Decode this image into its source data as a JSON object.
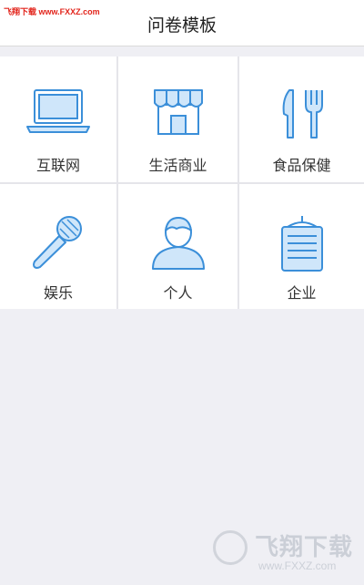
{
  "watermark_top": "飞翔下载 www.FXXZ.com",
  "header": {
    "title": "问卷模板"
  },
  "categories": [
    {
      "label": "互联网",
      "icon": "laptop-icon"
    },
    {
      "label": "生活商业",
      "icon": "storefront-icon"
    },
    {
      "label": "食品保健",
      "icon": "knife-fork-icon"
    },
    {
      "label": "娱乐",
      "icon": "microphone-icon"
    },
    {
      "label": "个人",
      "icon": "person-icon"
    },
    {
      "label": "企业",
      "icon": "clipboard-icon"
    }
  ],
  "watermark_bottom": {
    "name": "飞翔下载",
    "url": "www.FXXZ.com"
  },
  "colors": {
    "icon_stroke": "#3b8fd9",
    "icon_fill": "#cfe6fa",
    "background": "#efeff4"
  }
}
